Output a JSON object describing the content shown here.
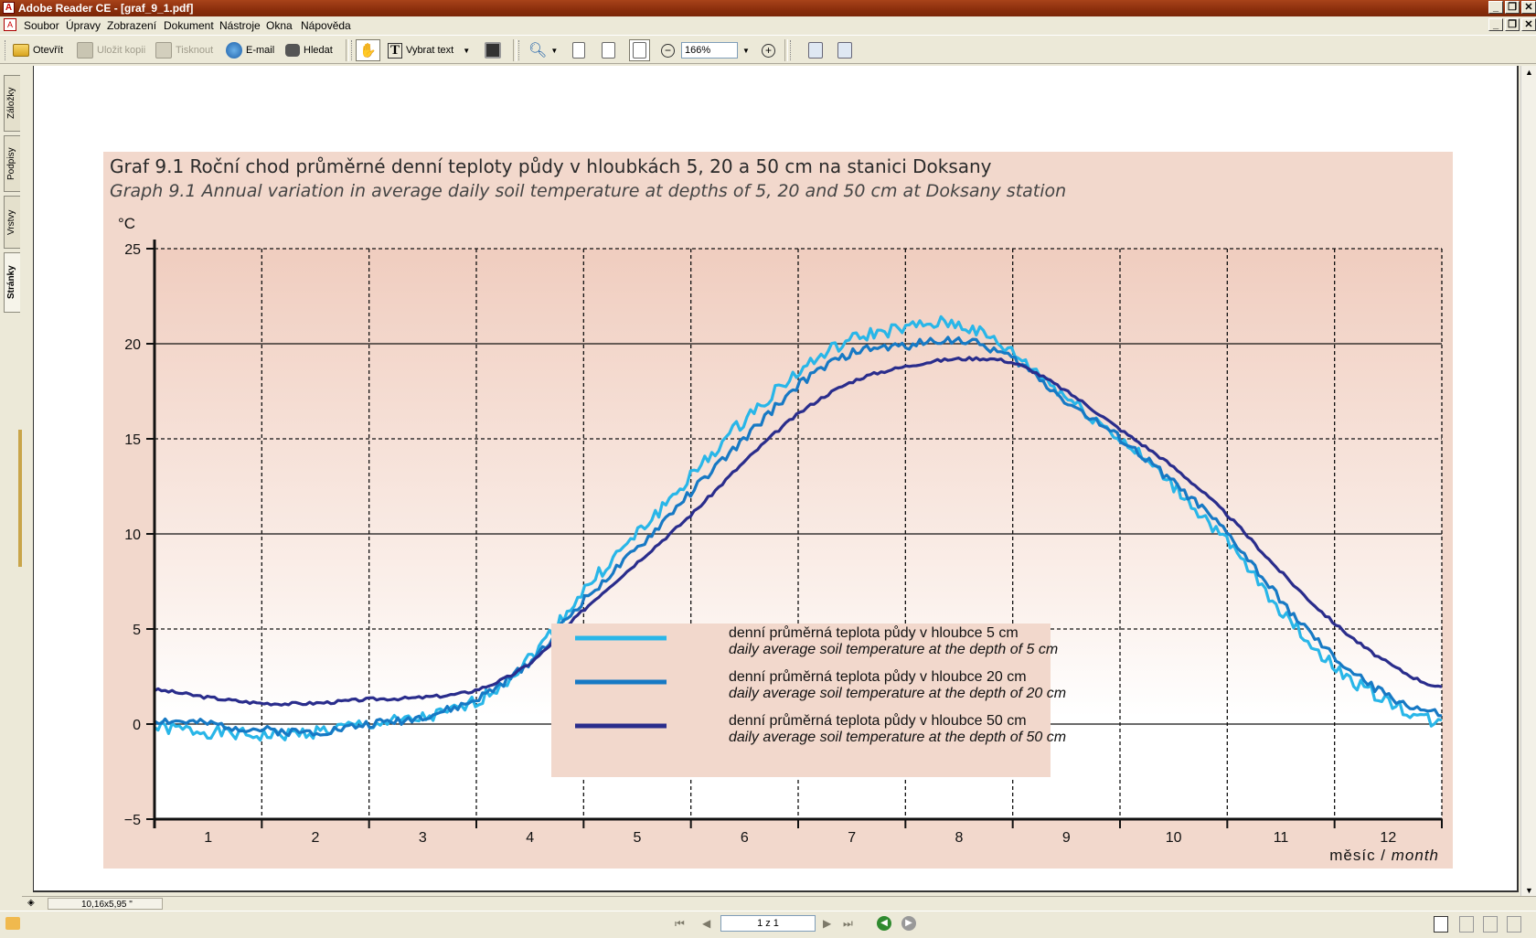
{
  "window": {
    "title": "Adobe Reader CE - [graf_9_1.pdf]",
    "controls": [
      "_",
      "❐",
      "✕"
    ]
  },
  "menu": [
    "Soubor",
    "Úpravy",
    "Zobrazení",
    "Dokument",
    "Nástroje",
    "Okna",
    "Nápověda"
  ],
  "toolbar": {
    "open_label": "Otevřít",
    "save_copy_label": "Uložit kopii",
    "print_label": "Tisknout",
    "email_label": "E-mail",
    "search_label": "Hledat",
    "select_text_label": "Vybrat text",
    "zoom_value": "166%"
  },
  "side_tabs": [
    "Záložky",
    "Podpisy",
    "Vrstvy",
    "Stránky"
  ],
  "status": {
    "page_size": "10,16x5,95 \"",
    "page_indicator": "1 z 1"
  },
  "chart_title_cz": "Graf 9.1  Roční chod průměrné denní teploty půdy v hloubkách 5, 20 a 50 cm na stanici Doksany",
  "chart_title_en": "Graph 9.1  Annual variation in average daily soil temperature at depths of 5, 20 and 50 cm at Doksany station",
  "chart_data": {
    "type": "line",
    "ylabel": "°C",
    "xlabel_cz": "měsíc",
    "xlabel_sep": "/",
    "xlabel_en": "month",
    "ylim": [
      -5,
      25
    ],
    "yticks": [
      -5,
      0,
      5,
      10,
      15,
      20,
      25
    ],
    "xlim": [
      0,
      12
    ],
    "categories": [
      "1",
      "2",
      "3",
      "4",
      "5",
      "6",
      "7",
      "8",
      "9",
      "10",
      "11",
      "12"
    ],
    "x": [
      0,
      0.5,
      1,
      1.5,
      2,
      2.5,
      3,
      3.5,
      4,
      4.5,
      5,
      5.5,
      6,
      6.5,
      7,
      7.5,
      8,
      8.5,
      9,
      9.5,
      10,
      10.5,
      11,
      11.5,
      12
    ],
    "series": [
      {
        "name": "denní průměrná teplota půdy v hloubce 5 cm",
        "name_en": "daily average soil temperature at the depth of 5 cm",
        "color": "#29b6e8",
        "values": [
          -0.2,
          -0.4,
          -0.6,
          -0.4,
          0.0,
          0.3,
          1.2,
          3.5,
          7.0,
          10.0,
          13.0,
          16.0,
          18.5,
          20.2,
          20.8,
          21.0,
          19.5,
          17.2,
          15.0,
          12.5,
          9.5,
          6.0,
          3.0,
          1.2,
          0.0
        ]
      },
      {
        "name": "denní průměrná teplota půdy v hloubce 20 cm",
        "name_en": "daily average soil temperature at the depth of 20 cm",
        "color": "#1779c4",
        "values": [
          0.2,
          0.0,
          -0.3,
          -0.4,
          0.0,
          0.4,
          1.3,
          3.3,
          6.5,
          9.2,
          12.2,
          15.0,
          17.8,
          19.5,
          19.9,
          20.2,
          19.2,
          17.0,
          15.0,
          12.7,
          10.0,
          6.5,
          3.5,
          1.5,
          0.5
        ]
      },
      {
        "name": "denní průměrná teplota půdy v hloubce 50 cm",
        "name_en": "daily average soil temperature at the depth of 50 cm",
        "color": "#2a2d8c",
        "values": [
          1.8,
          1.4,
          1.1,
          1.1,
          1.3,
          1.4,
          1.8,
          3.2,
          6.0,
          8.5,
          11.0,
          13.8,
          16.3,
          18.0,
          18.8,
          19.2,
          19.0,
          17.5,
          15.5,
          13.5,
          11.0,
          8.0,
          5.3,
          3.2,
          1.9
        ]
      }
    ],
    "legend_position": "bottom-center",
    "grid": true
  }
}
